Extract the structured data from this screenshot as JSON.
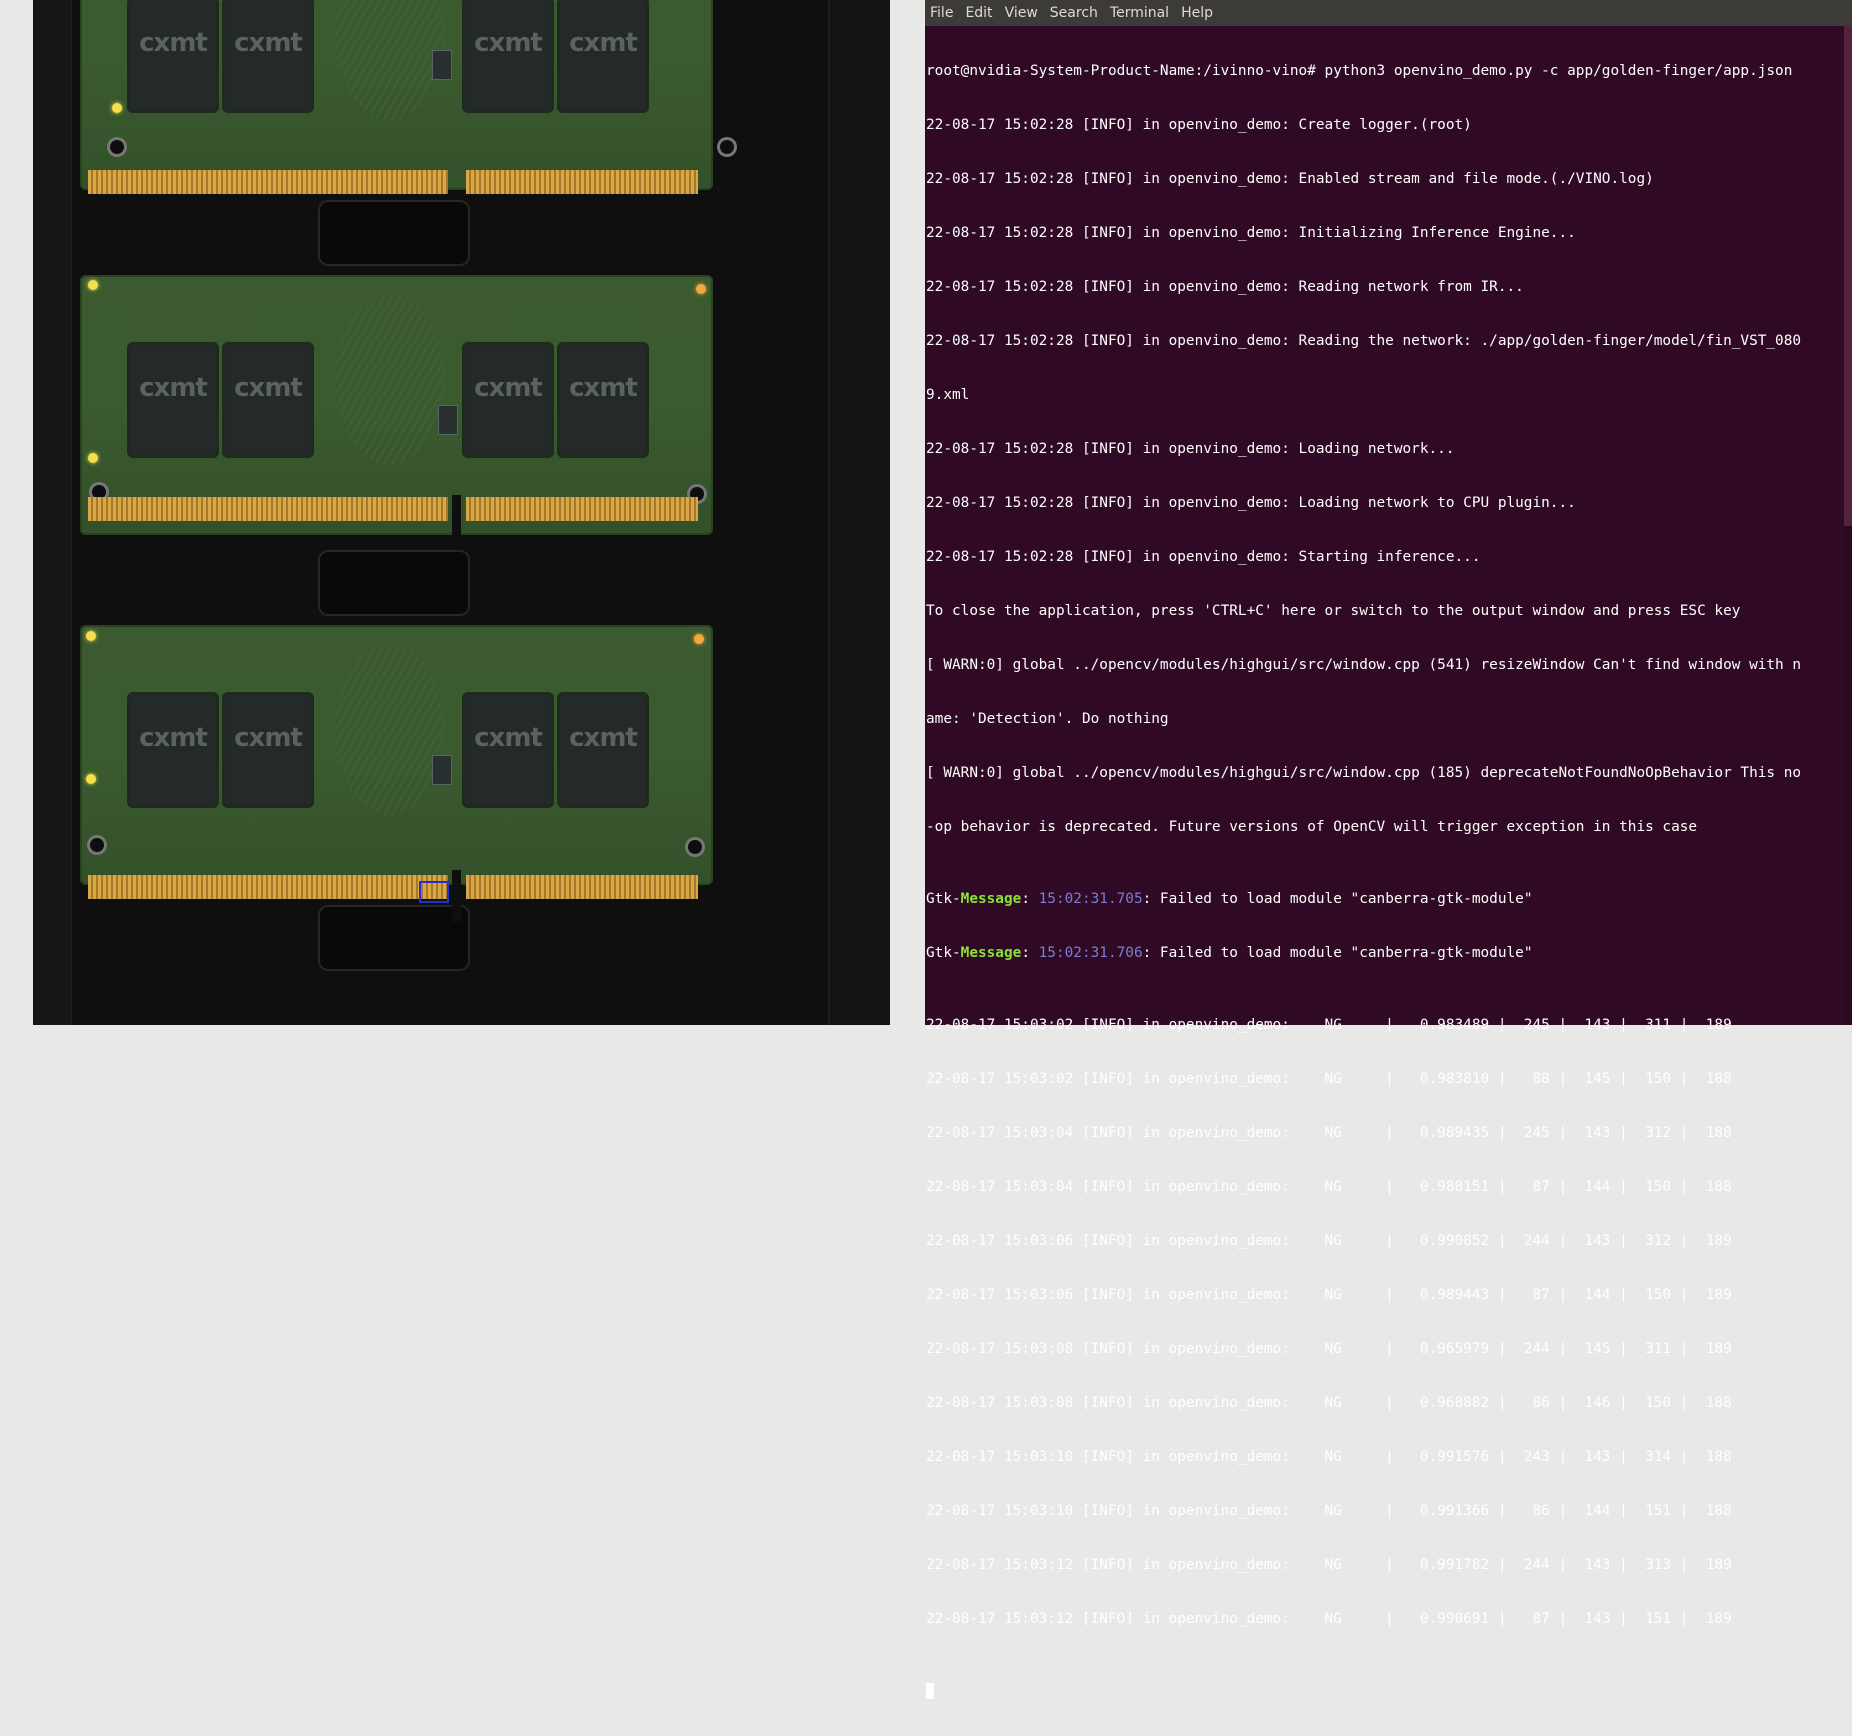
{
  "menubar": {
    "items": [
      "File",
      "Edit",
      "View",
      "Search",
      "Terminal",
      "Help"
    ]
  },
  "terminal": {
    "lines": [
      "root@nvidia-System-Product-Name:/ivinno-vino# python3 openvino_demo.py -c app/golden-finger/app.json",
      "22-08-17 15:02:28 [INFO] in openvino_demo: Create logger.(root)",
      "22-08-17 15:02:28 [INFO] in openvino_demo: Enabled stream and file mode.(./VINO.log)",
      "22-08-17 15:02:28 [INFO] in openvino_demo: Initializing Inference Engine...",
      "22-08-17 15:02:28 [INFO] in openvino_demo: Reading network from IR...",
      "22-08-17 15:02:28 [INFO] in openvino_demo: Reading the network: ./app/golden-finger/model/fin_VST_080",
      "9.xml",
      "22-08-17 15:02:28 [INFO] in openvino_demo: Loading network...",
      "22-08-17 15:02:28 [INFO] in openvino_demo: Loading network to CPU plugin...",
      "22-08-17 15:02:28 [INFO] in openvino_demo: Starting inference...",
      "To close the application, press 'CTRL+C' here or switch to the output window and press ESC key",
      "[ WARN:0] global ../opencv/modules/highgui/src/window.cpp (541) resizeWindow Can't find window with n",
      "ame: 'Detection'. Do nothing",
      "[ WARN:0] global ../opencv/modules/highgui/src/window.cpp (185) deprecateNotFoundNoOpBehavior This no",
      "-op behavior is deprecated. Future versions of OpenCV will trigger exception in this case"
    ],
    "gtk_lines": [
      {
        "prefix": "Gtk-",
        "label": "Message",
        "sep": ": ",
        "time": "15:02:31.705",
        "text": ": Failed to load module \"canberra-gtk-module\""
      },
      {
        "prefix": "Gtk-",
        "label": "Message",
        "sep": ": ",
        "time": "15:02:31.706",
        "text": ": Failed to load module \"canberra-gtk-module\""
      }
    ],
    "result_lines": [
      "22-08-17 15:03:02 [INFO] in openvino_demo:    NG     |   0.983489 |  245 |  143 |  311 |  189",
      "22-08-17 15:03:02 [INFO] in openvino_demo:    NG     |   0.983810 |   88 |  145 |  150 |  188",
      "22-08-17 15:03:04 [INFO] in openvino_demo:    NG     |   0.989435 |  245 |  143 |  312 |  188",
      "22-08-17 15:03:04 [INFO] in openvino_demo:    NG     |   0.988151 |   87 |  144 |  150 |  188",
      "22-08-17 15:03:06 [INFO] in openvino_demo:    NG     |   0.990852 |  244 |  143 |  312 |  189",
      "22-08-17 15:03:06 [INFO] in openvino_demo:    NG     |   0.989443 |   87 |  144 |  150 |  189",
      "22-08-17 15:03:08 [INFO] in openvino_demo:    NG     |   0.965979 |  244 |  145 |  311 |  189",
      "22-08-17 15:03:08 [INFO] in openvino_demo:    NG     |   0.968882 |   86 |  146 |  150 |  188",
      "22-08-17 15:03:10 [INFO] in openvino_demo:    NG     |   0.991576 |  243 |  143 |  314 |  188",
      "22-08-17 15:03:10 [INFO] in openvino_demo:    NG     |   0.991366 |   86 |  144 |  151 |  188",
      "22-08-17 15:03:12 [INFO] in openvino_demo:    NG     |   0.991782 |  244 |  143 |  313 |  189",
      "22-08-17 15:03:12 [INFO] in openvino_demo:    NG     |   0.990691 |   87 |  143 |  151 |  189"
    ]
  },
  "viewer": {
    "chip_text": "cxmt"
  },
  "colors": {
    "terminal_bg": "#300a24",
    "menubar_bg": "#3c3b37",
    "gtk_message": "#8ae234",
    "gtk_time": "#7b7dd8",
    "detect_box": "#2231d6"
  }
}
